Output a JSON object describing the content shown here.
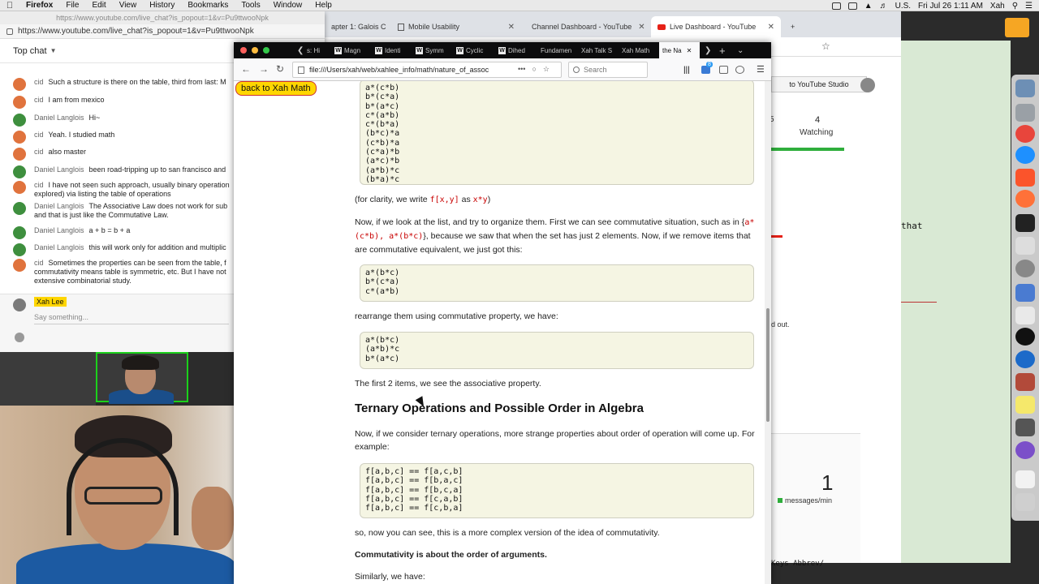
{
  "menubar": {
    "app": "Firefox",
    "items": [
      "File",
      "Edit",
      "View",
      "History",
      "Bookmarks",
      "Tools",
      "Window",
      "Help"
    ],
    "locale": "U.S.",
    "clock": "Fri Jul 26  1:11 AM",
    "user": "Xah"
  },
  "bg_browser": {
    "tabs": [
      {
        "label": "apter 1: Galois C",
        "icon": "doc-icon"
      },
      {
        "label": "Mobile Usability",
        "icon": "doc-icon"
      },
      {
        "label": "Channel Dashboard - YouTube",
        "icon": "youtube-icon"
      },
      {
        "label": "Live Dashboard - YouTube",
        "icon": "youtube-icon"
      }
    ],
    "studio_button": "to YouTube Studio",
    "stat_partial": "5",
    "watching_count": "4",
    "watching_label": "Watching",
    "faded_text": "d out.",
    "messages_count": "1",
    "messages_label": "messages/min"
  },
  "terminal": {
    "line_that": "that",
    "bottom_text": "Keys  Abbrev/"
  },
  "chat": {
    "popout_title": "https://www.youtube.com/live_chat?is_popout=1&v=Pu9ttwooNpk",
    "url": "https://www.youtube.com/live_chat?is_popout=1&v=Pu9ttwooNpk",
    "header": "Top chat",
    "messages": [
      {
        "author": "cid",
        "text": "Such a structure is there on the table, third from last: M",
        "avatar": "orange"
      },
      {
        "author": "cid",
        "text": "I am from mexico",
        "avatar": "orange"
      },
      {
        "author": "Daniel Langlois",
        "text": "Hi~",
        "avatar": "green"
      },
      {
        "author": "cid",
        "text": "Yeah. I studied math",
        "avatar": "orange"
      },
      {
        "author": "cid",
        "text": "also master",
        "avatar": "orange"
      },
      {
        "author": "Daniel Langlois",
        "text": "been road-tripping up to san francisco and",
        "avatar": "green"
      },
      {
        "author": "cid",
        "text": "I have not seen such approach, usually binary operation explored) via listing the table of operations",
        "avatar": "orange"
      },
      {
        "author": "Daniel Langlois",
        "text": "The Associative Law does not work for sub and that is just like the Commutative Law.",
        "avatar": "green"
      },
      {
        "author": "Daniel Langlois",
        "text": "a + b = b + a",
        "avatar": "green"
      },
      {
        "author": "Daniel Langlois",
        "text": "this will work only for addition and multiplic",
        "avatar": "green"
      },
      {
        "author": "cid",
        "text": "Sometimes the properties can be seen from the table, f commutativity means table is symmetric, etc. But I have not extensive combinatorial study.",
        "avatar": "orange"
      }
    ],
    "me": "Xah Lee",
    "input_placeholder": "Say something..."
  },
  "firefox": {
    "tabs": [
      {
        "label": "s: Hi",
        "icon": "W"
      },
      {
        "label": "Magn",
        "icon": "W"
      },
      {
        "label": "Identi",
        "icon": "W"
      },
      {
        "label": "Symm",
        "icon": "W"
      },
      {
        "label": "Cyclic",
        "icon": "W"
      },
      {
        "label": "Dihed",
        "icon": "W"
      },
      {
        "label": "Fundamen",
        "icon": ""
      },
      {
        "label": "Xah Talk S",
        "icon": ""
      },
      {
        "label": "Xah Math",
        "icon": ""
      },
      {
        "label": "the Na",
        "icon": ""
      }
    ],
    "url": "file:///Users/xah/web/xahlee_info/math/nature_of_assoc",
    "search_placeholder": "Search",
    "notif_badge": "8"
  },
  "page": {
    "back_link": "back to Xah Math",
    "code1": "a*(c*b)\nb*(c*a)\nb*(a*c)\nc*(a*b)\nc*(b*a)\n(b*c)*a\n(c*b)*a\n(c*a)*b\n(a*c)*b\n(a*b)*c\n(b*a)*c",
    "clarity_pre": "(for clarity, we write ",
    "clarity_code1": "f[x,y]",
    "clarity_mid": " as ",
    "clarity_code2": "x*y",
    "clarity_post": ")",
    "p1_a": "Now, if we look at the list, and try to organize them. First we can see commutative situation, such as in {",
    "p1_code": "a*(c*b), a*(b*c)",
    "p1_b": "}, because we saw that when the set has just 2 elements. Now, if we remove items that are commutative equivalent, we just got this:",
    "code2": "a*(b*c)\nb*(c*a)\nc*(a*b)",
    "p2": "rearrange them using commutative property, we have:",
    "code3": "a*(b*c)\n(a*b)*c\nb*(a*c)",
    "p3": "The first 2 items, we see the associative property.",
    "heading": "Ternary Operations and Possible Order in Algebra",
    "p4": "Now, if we consider ternary operations, more strange properties about order of operation will come up. For example:",
    "code4": "f[a,b,c] == f[a,c,b]\nf[a,b,c] == f[b,a,c]\nf[a,b,c] == f[b,c,a]\nf[a,b,c] == f[c,a,b]\nf[a,b,c] == f[c,b,a]",
    "p5": "so, now you can see, this is a more complex version of the idea of commutativity.",
    "p6": "Commutativity is about the order of arguments.",
    "p7": "Similarly, we have:"
  }
}
